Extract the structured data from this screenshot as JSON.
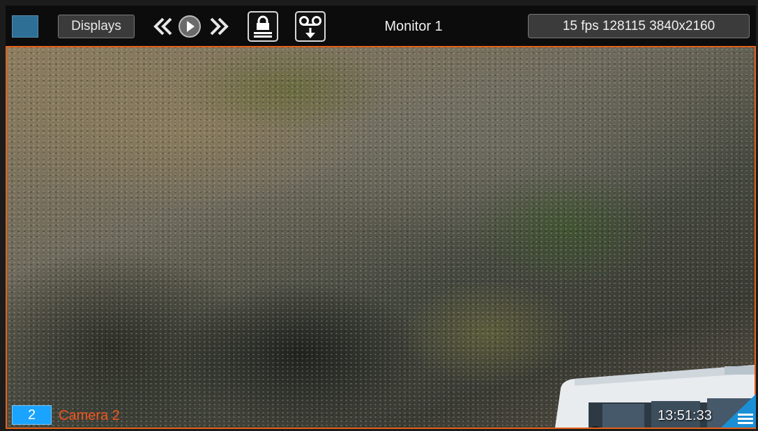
{
  "toolbar": {
    "displays_label": "Displays",
    "monitor_title": "Monitor 1",
    "status": "15 fps 128115 3840x2160"
  },
  "overlay": {
    "camera_number": "2",
    "camera_name": "Camera 2",
    "timestamp": "13:51:33"
  },
  "icons": [
    "layout-square-icon",
    "rewind-icon",
    "play-icon",
    "fast-forward-icon",
    "lock-icon",
    "voicemail-download-icon",
    "menu-corner-icon"
  ],
  "colors": {
    "accent_orange": "#e5621a",
    "camera_number_bg": "#1aa3ff",
    "camera_name": "#f2561d",
    "toolbar_bg": "#0c0c0c"
  }
}
